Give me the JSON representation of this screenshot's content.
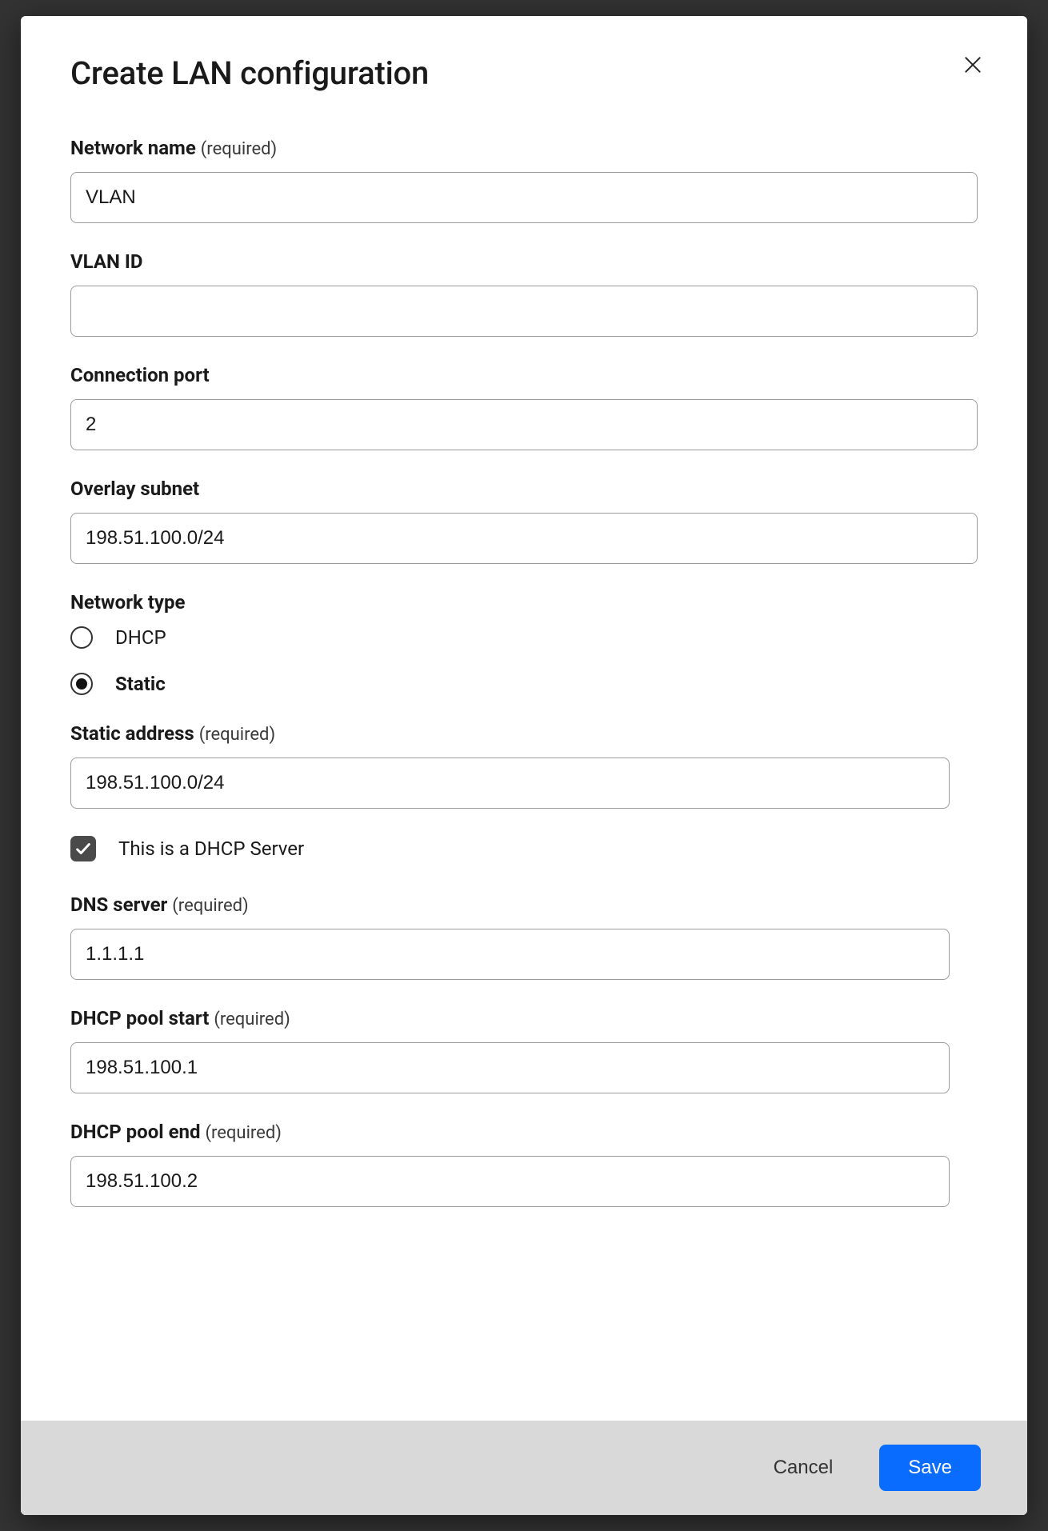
{
  "dialog": {
    "title": "Create LAN configuration",
    "required_suffix": "(required)",
    "fields": {
      "network_name": {
        "label": "Network name",
        "value": "VLAN",
        "required": true
      },
      "vlan_id": {
        "label": "VLAN ID",
        "value": "",
        "required": false
      },
      "connection_port": {
        "label": "Connection port",
        "value": "2",
        "required": false
      },
      "overlay_subnet": {
        "label": "Overlay subnet",
        "value": "198.51.100.0/24",
        "required": false
      },
      "network_type": {
        "label": "Network type",
        "options": [
          {
            "key": "dhcp",
            "label": "DHCP",
            "selected": false
          },
          {
            "key": "static",
            "label": "Static",
            "selected": true
          }
        ]
      },
      "static_address": {
        "label": "Static address",
        "value": "198.51.100.0/24",
        "required": true
      },
      "dhcp_server_checkbox": {
        "label": "This is a DHCP Server",
        "checked": true
      },
      "dns_server": {
        "label": "DNS server",
        "value": "1.1.1.1",
        "required": true
      },
      "dhcp_pool_start": {
        "label": "DHCP pool start",
        "value": "198.51.100.1",
        "required": true
      },
      "dhcp_pool_end": {
        "label": "DHCP pool end",
        "value": "198.51.100.2",
        "required": true
      }
    },
    "footer": {
      "cancel_label": "Cancel",
      "save_label": "Save"
    }
  }
}
